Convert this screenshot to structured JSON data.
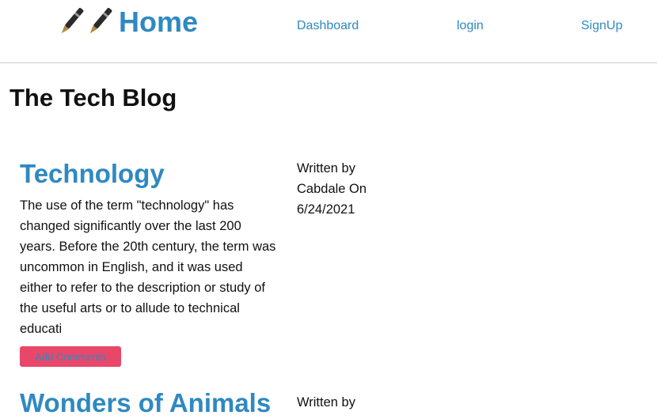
{
  "nav": {
    "brand_label": "Home",
    "brand_icons": [
      "fountain-pen-icon",
      "fountain-pen-icon"
    ],
    "links": [
      "Dashboard",
      "login",
      "SignUp"
    ]
  },
  "page": {
    "title": "The Tech Blog"
  },
  "posts": [
    {
      "title": "Technology",
      "body": "The use of the term \"technology\" has changed significantly over the last 200 years. Before the 20th century, the term was uncommon in English, and it was used either to refer to the description or study of the useful arts or to allude to technical educati",
      "meta": "Written by Cabdale On 6/24/2021",
      "button_label": "Add Comments"
    },
    {
      "title": "Wonders of Animals",
      "meta": "Written by"
    }
  ],
  "colors": {
    "link": "#2f89c1",
    "button_bg": "#e9476a",
    "title": "#111111"
  }
}
